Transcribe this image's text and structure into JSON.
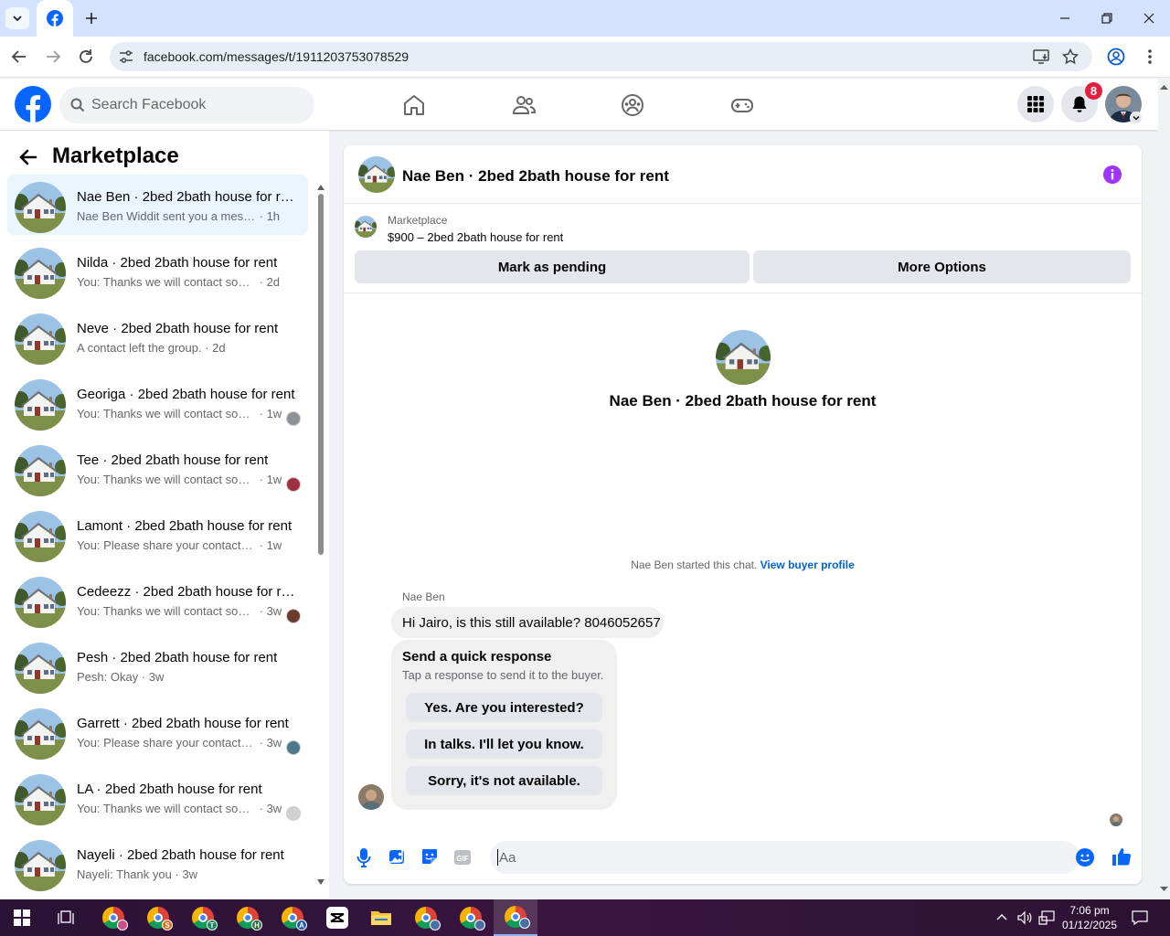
{
  "browser": {
    "url": "facebook.com/messages/t/1911203753078529",
    "tab_favicon": "facebook-icon"
  },
  "header": {
    "search_placeholder": "Search Facebook",
    "notifications_count": "8"
  },
  "sidebar": {
    "title": "Marketplace",
    "conversations": [
      {
        "title": "Nae Ben · 2bed 2bath house for rent",
        "snippet": "Nae Ben Widdit sent you a message about your listing",
        "time": "1h",
        "active": true
      },
      {
        "title": "Nilda · 2bed 2bath house for rent",
        "snippet": "You: Thanks we will contact soon with available dates",
        "time": "2d"
      },
      {
        "title": "Neve · 2bed 2bath house for rent",
        "snippet": "A contact left the group.",
        "time": "2d"
      },
      {
        "title": "Georiga · 2bed 2bath house for rent",
        "snippet": "You: Thanks we will contact soon with available dates",
        "time": "1w"
      },
      {
        "title": "Tee · 2bed 2bath house for rent",
        "snippet": "You: Thanks we will contact soon with available dates",
        "time": "1w"
      },
      {
        "title": "Lamont · 2bed 2bath house for rent",
        "snippet": "You: Please share your contact number",
        "time": "1w"
      },
      {
        "title": "Cedeezz · 2bed 2bath house for rent",
        "snippet": "You: Thanks we will contact soon with available dates",
        "time": "3w"
      },
      {
        "title": "Pesh · 2bed 2bath house for rent",
        "snippet": "Pesh: Okay",
        "time": "3w"
      },
      {
        "title": "Garrett · 2bed 2bath house for rent",
        "snippet": "You: Please share your contact number",
        "time": "3w"
      },
      {
        "title": "LA · 2bed 2bath house for rent",
        "snippet": "You: Thanks we will contact soon with available dates",
        "time": "3w"
      },
      {
        "title": "Nayeli · 2bed 2bath house for rent",
        "snippet": "Nayeli: Thank you",
        "time": "3w"
      }
    ]
  },
  "chat": {
    "title": "Nae Ben · 2bed 2bath house for rent",
    "listing_source": "Marketplace",
    "listing_line": "$900 – 2bed 2bath house for rent",
    "mark_pending": "Mark as pending",
    "more_options": "More Options",
    "intro_name": "Nae Ben · 2bed 2bath house for rent",
    "started_text": "Nae Ben started this chat.",
    "buyer_profile_link": "View buyer profile",
    "sender": "Nae Ben",
    "message": "Hi Jairo, is this still available? 8046052657",
    "quick_title": "Send a quick response",
    "quick_sub": "Tap a response to send it to the buyer.",
    "quick_replies": [
      "Yes. Are you interested?",
      "In talks. I'll let you know.",
      "Sorry, it's not available."
    ],
    "composer_placeholder": "Aa"
  },
  "taskbar": {
    "time": "7:06 pm",
    "date": "01/12/2025"
  },
  "colors": {
    "fb_blue": "#0866ff",
    "link_blue": "#0064d1",
    "notif_red": "#e41e3f",
    "info_purple": "#a033ff"
  }
}
